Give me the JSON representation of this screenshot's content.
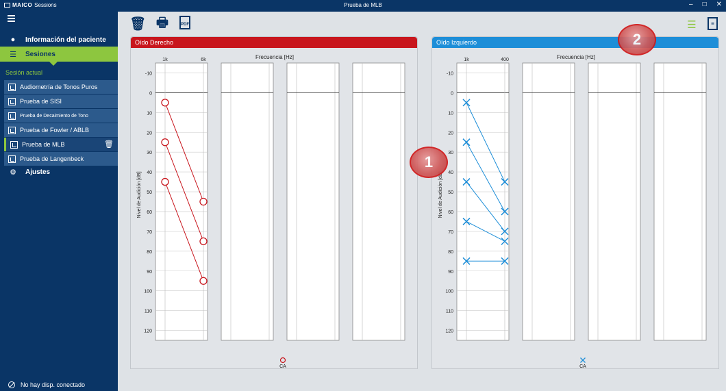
{
  "window": {
    "brand": "MAICO",
    "app_name": "Sessions",
    "title": "Prueba de MLB",
    "controls": [
      "–",
      "□",
      "✕"
    ]
  },
  "sidebar": {
    "patient_info": "Información del paciente",
    "sessions": "Sesiones",
    "current_session_label": "Sesión actual",
    "tests": [
      {
        "label": "Audiometría de Tonos Puros",
        "small": false
      },
      {
        "label": "Prueba de SISI",
        "small": false
      },
      {
        "label": "Prueba de Decaimiento de Tono",
        "small": true
      },
      {
        "label": "Prueba de Fowler / ABLB",
        "small": false
      },
      {
        "label": "Prueba de MLB",
        "small": false,
        "active": true
      },
      {
        "label": "Prueba de Langenbeck",
        "small": false
      }
    ],
    "settings": "Ajustes",
    "status": "No hay disp. conectado"
  },
  "toolbar": {
    "icons": [
      "trash-icon",
      "print-icon",
      "pdf-icon"
    ],
    "pdf_label": "PDF"
  },
  "top_right_icons": [
    "checklist-icon",
    "clipboard-icon"
  ],
  "badges": {
    "one": "1",
    "two": "2"
  },
  "colors": {
    "navy": "#0a3566",
    "green": "#8dc63f",
    "right_ear": "#c8161d",
    "left_ear": "#1d8ed8"
  },
  "chart_data": [
    {
      "type": "line",
      "title": "Oído Derecho",
      "xlabel": "Frecuencia [Hz]",
      "ylabel": "Nivel de Audición [dB]",
      "x_ticks": [
        "1k",
        "6k"
      ],
      "y_ticks": [
        -10,
        0,
        10,
        20,
        30,
        40,
        50,
        60,
        70,
        80,
        90,
        100,
        110,
        120
      ],
      "ylim": [
        -15,
        125
      ],
      "y_inverted": true,
      "marker": "circle",
      "legend": "CA",
      "series": [
        {
          "values": [
            5,
            55
          ]
        },
        {
          "values": [
            25,
            75
          ]
        },
        {
          "values": [
            45,
            95
          ]
        }
      ]
    },
    {
      "type": "line",
      "title": "Oído Izquierdo",
      "xlabel": "Frecuencia [Hz]",
      "ylabel": "Nivel de Audición [dB]",
      "x_ticks": [
        "1k",
        "400"
      ],
      "y_ticks": [
        -10,
        0,
        10,
        20,
        30,
        40,
        50,
        60,
        70,
        80,
        90,
        100,
        110,
        120
      ],
      "ylim": [
        -15,
        125
      ],
      "y_inverted": true,
      "marker": "cross",
      "legend": "CA",
      "series": [
        {
          "values": [
            5,
            45
          ]
        },
        {
          "values": [
            25,
            60
          ]
        },
        {
          "values": [
            45,
            70
          ]
        },
        {
          "values": [
            65,
            75
          ]
        },
        {
          "values": [
            85,
            85
          ]
        }
      ]
    }
  ]
}
